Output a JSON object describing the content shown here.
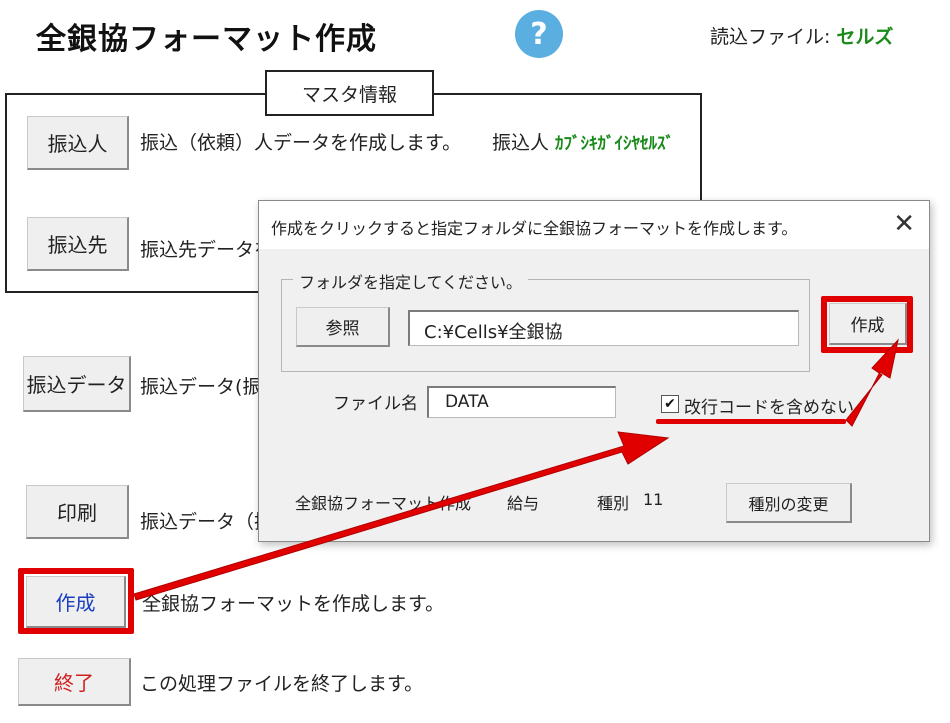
{
  "header": {
    "title": "全銀協フォーマット作成",
    "help_icon": "?",
    "read_file_label": "読込ファイル:",
    "read_file_value": "セルズ"
  },
  "master": {
    "label": "マスタ情報",
    "payer_button": "振込人",
    "payer_desc": "振込（依頼）人データを作成します。",
    "payer_name_label": "振込人",
    "payer_name_value": "ｶﾌﾞｼｷｶﾞｲｼﾔｾﾙｽﾞ",
    "payee_button": "振込先",
    "payee_desc": "振込先データを"
  },
  "main": {
    "transfer_data_button": "振込データ",
    "transfer_data_desc": "振込データ(振込",
    "print_button": "印刷",
    "print_desc": "振込データ（振込",
    "create_button": "作成",
    "create_desc": "全銀協フォーマットを作成します。",
    "exit_button": "終了",
    "exit_desc": "この処理ファイルを終了します。"
  },
  "dialog": {
    "title": "作成をクリックすると指定フォルダに全銀協フォーマットを作成します。",
    "close_icon": "✕",
    "folder_group_label": "フォルダを指定してください。",
    "browse_button": "参照",
    "folder_path": "C:¥Cells¥全銀協",
    "create_button": "作成",
    "filename_label": "ファイル名",
    "filename_value": "DATA",
    "no_newline_checked": true,
    "no_newline_label": "改行コードを含めない",
    "info_label": "全銀協フォーマット作成",
    "info_type": "給与",
    "kind_label": "種別",
    "kind_value": "11",
    "change_kind_button": "種別の変更"
  },
  "colors": {
    "highlight_red": "#e00000",
    "accent_green": "#1a8a1a",
    "help_blue": "#5aaee0"
  }
}
